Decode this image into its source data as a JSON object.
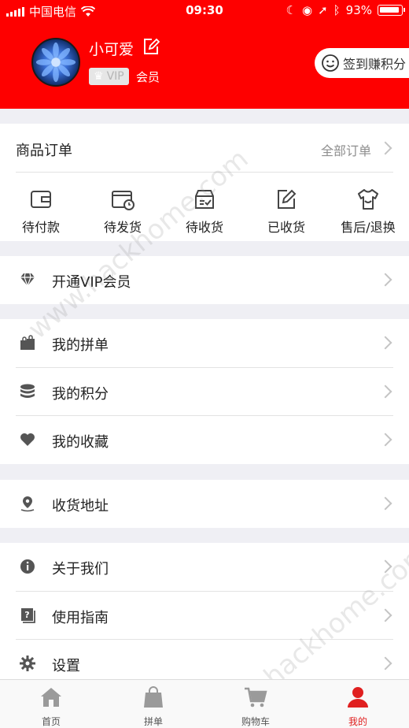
{
  "status_bar": {
    "carrier": "中国电信",
    "time": "09:30",
    "battery": "93%"
  },
  "profile": {
    "username": "小可爱",
    "vip_badge": "VIP",
    "member_label": "会员",
    "checkin_label": "签到赚积分"
  },
  "orders": {
    "title": "商品订单",
    "all_label": "全部订单",
    "items": [
      {
        "label": "待付款",
        "icon": "wallet-icon"
      },
      {
        "label": "待发货",
        "icon": "box-clock-icon"
      },
      {
        "label": "待收货",
        "icon": "box-check-icon"
      },
      {
        "label": "已收货",
        "icon": "edit-note-icon"
      },
      {
        "label": "售后/退换",
        "icon": "shirt-icon"
      }
    ]
  },
  "vip_row": {
    "label": "开通VIP会员",
    "icon": "diamond-icon"
  },
  "menu_group_1": [
    {
      "label": "我的拼单",
      "icon": "shopping-bag-icon"
    },
    {
      "label": "我的积分",
      "icon": "coins-stack-icon"
    },
    {
      "label": "我的收藏",
      "icon": "heart-icon"
    }
  ],
  "address_row": {
    "label": "收货地址",
    "icon": "location-pin-icon"
  },
  "menu_group_2": [
    {
      "label": "关于我们",
      "icon": "info-icon"
    },
    {
      "label": "使用指南",
      "icon": "help-book-icon"
    },
    {
      "label": "设置",
      "icon": "gear-icon"
    }
  ],
  "tabbar": {
    "tabs": [
      {
        "label": "首页",
        "icon": "home-icon"
      },
      {
        "label": "拼单",
        "icon": "bag-icon"
      },
      {
        "label": "购物车",
        "icon": "cart-icon"
      },
      {
        "label": "我的",
        "icon": "person-icon",
        "active": true
      }
    ]
  },
  "watermark": "www.hackhome.com",
  "colors": {
    "brand_red": "#fe0000",
    "active_tab": "#e02020",
    "background": "#efeff4"
  }
}
